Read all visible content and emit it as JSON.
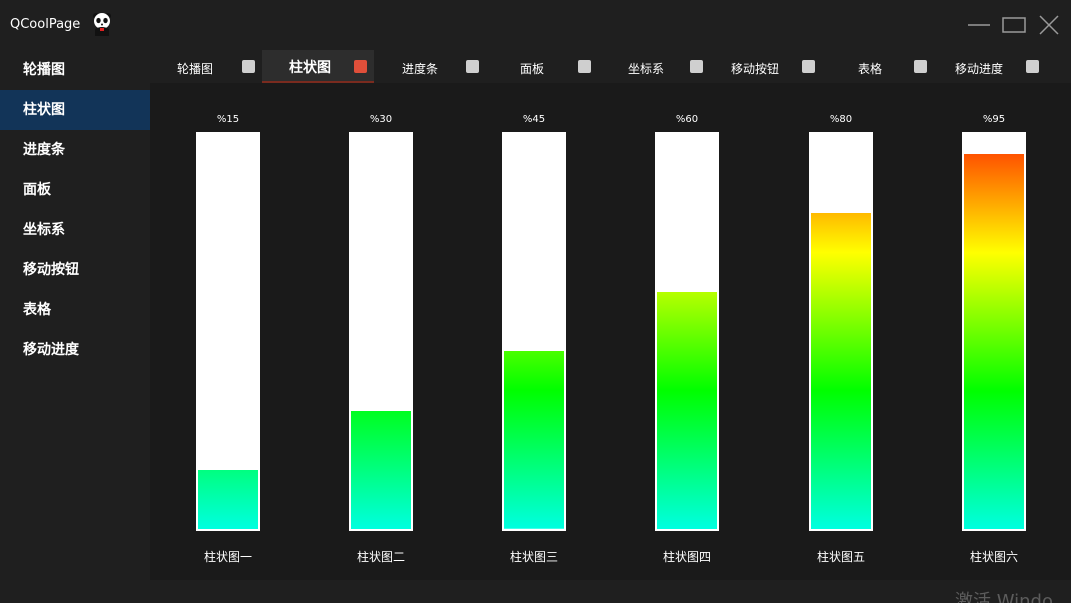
{
  "window": {
    "title": "QCoolPage",
    "logo_icon": "panda-icon"
  },
  "sidebar": {
    "items": [
      {
        "label": "轮播图",
        "active": false
      },
      {
        "label": "柱状图",
        "active": true
      },
      {
        "label": "进度条",
        "active": false
      },
      {
        "label": "面板",
        "active": false
      },
      {
        "label": "坐标系",
        "active": false
      },
      {
        "label": "移动按钮",
        "active": false
      },
      {
        "label": "表格",
        "active": false
      },
      {
        "label": "移动进度",
        "active": false
      }
    ]
  },
  "tabs": [
    {
      "label": "轮播图",
      "active": false
    },
    {
      "label": "柱状图",
      "active": true
    },
    {
      "label": "进度条",
      "active": false
    },
    {
      "label": "面板",
      "active": false
    },
    {
      "label": "坐标系",
      "active": false
    },
    {
      "label": "移动按钮",
      "active": false
    },
    {
      "label": "表格",
      "active": false
    },
    {
      "label": "移动进度",
      "active": false
    }
  ],
  "bars": [
    {
      "name": "柱状图一",
      "value": 15,
      "label": "%15"
    },
    {
      "name": "柱状图二",
      "value": 30,
      "label": "%30"
    },
    {
      "name": "柱状图三",
      "value": 45,
      "label": "%45"
    },
    {
      "name": "柱状图四",
      "value": 60,
      "label": "%60"
    },
    {
      "name": "柱状图五",
      "value": 80,
      "label": "%80"
    },
    {
      "name": "柱状图六",
      "value": 95,
      "label": "%95"
    }
  ],
  "colors": {
    "sidebar_active": "#123458",
    "tab_close_active": "#e04f3a",
    "gradient_bottom": "#00ffe0",
    "gradient_mid_green": "#00ff00",
    "gradient_yellow": "#ffff00",
    "gradient_top_red": "#ff3000"
  },
  "watermark": "激活 Windo"
}
